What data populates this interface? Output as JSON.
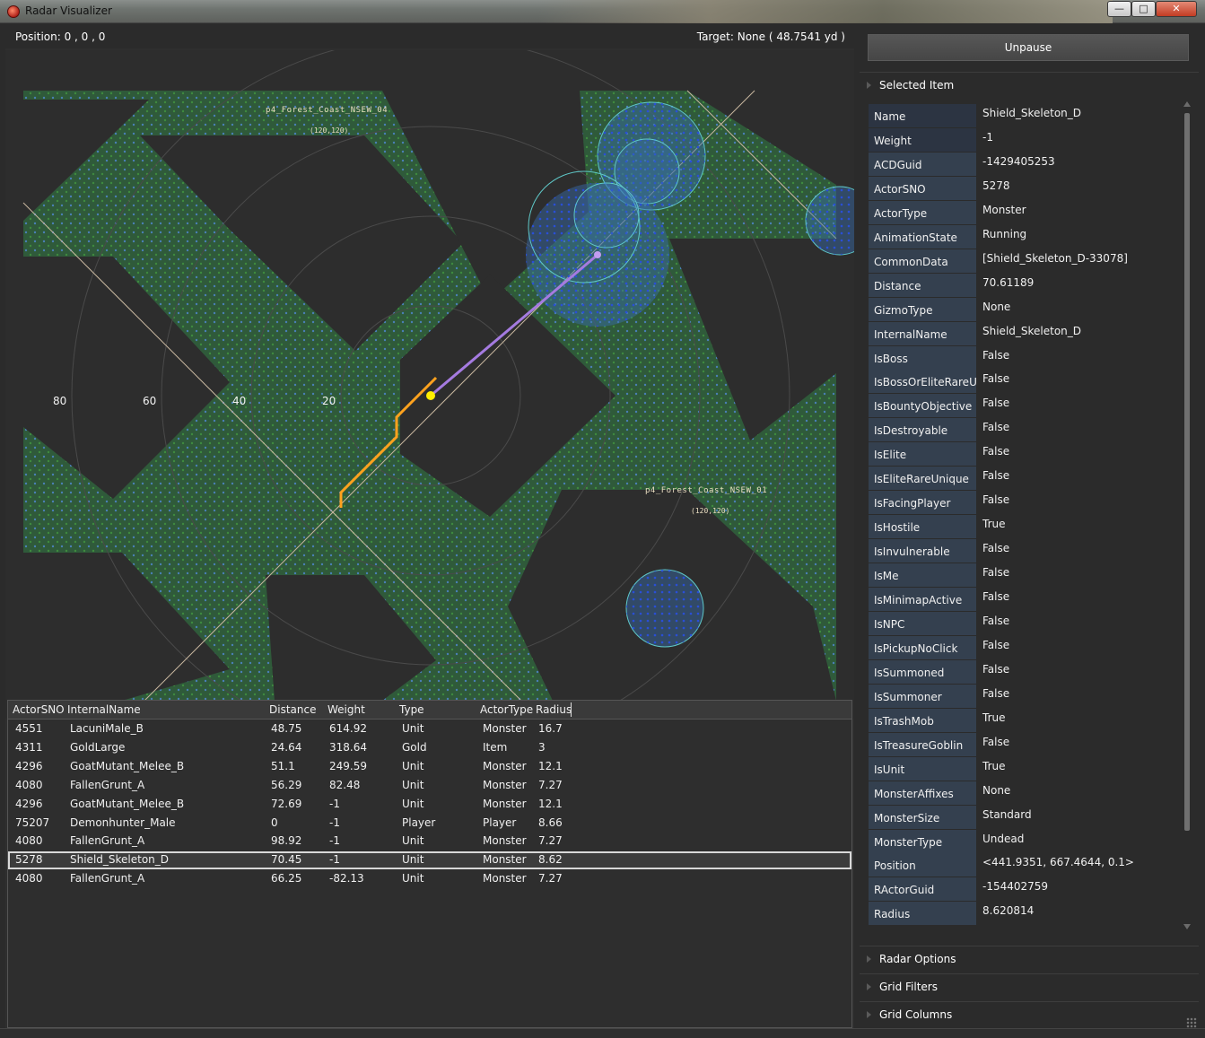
{
  "window": {
    "title": "Radar Visualizer"
  },
  "info": {
    "position": "Position: 0 , 0 , 0",
    "target": "Target: None ( 48.7541 yd )"
  },
  "radar": {
    "ring_labels": [
      "80",
      "60",
      "40",
      "20"
    ],
    "scenes": [
      {
        "name": "p4_Forest_Coast_NSEW_04",
        "coords": "(120,120)"
      },
      {
        "name": "p4_Forest_Coast_NSEW_01",
        "coords": "(120,120)"
      }
    ],
    "colors": {
      "walkable": "#2f5a3a",
      "player": "#ffee00",
      "path": "#ff9f1a",
      "target_line": "#a57be0",
      "monster": "#3a6fb0"
    }
  },
  "grid": {
    "columns": [
      "ActorSNO",
      "InternalName",
      "Distance",
      "Weight",
      "Type",
      "ActorType",
      "Radius"
    ],
    "rows": [
      [
        "4551",
        "LacuniMale_B",
        "48.75",
        "614.92",
        "Unit",
        "Monster",
        "16.7"
      ],
      [
        "4311",
        "GoldLarge",
        "24.64",
        "318.64",
        "Gold",
        "Item",
        "3"
      ],
      [
        "4296",
        "GoatMutant_Melee_B",
        "51.1",
        "249.59",
        "Unit",
        "Monster",
        "12.1"
      ],
      [
        "4080",
        "FallenGrunt_A",
        "56.29",
        "82.48",
        "Unit",
        "Monster",
        "7.27"
      ],
      [
        "4296",
        "GoatMutant_Melee_B",
        "72.69",
        "-1",
        "Unit",
        "Monster",
        "12.1"
      ],
      [
        "75207",
        "Demonhunter_Male",
        "0",
        "-1",
        "Player",
        "Player",
        "8.66"
      ],
      [
        "4080",
        "FallenGrunt_A",
        "98.92",
        "-1",
        "Unit",
        "Monster",
        "7.27"
      ],
      [
        "5278",
        "Shield_Skeleton_D",
        "70.45",
        "-1",
        "Unit",
        "Monster",
        "8.62"
      ],
      [
        "4080",
        "FallenGrunt_A",
        "66.25",
        "-82.13",
        "Unit",
        "Monster",
        "7.27"
      ]
    ],
    "selected_row": 7
  },
  "side": {
    "unpause_label": "Unpause",
    "selected_item_header": "Selected Item",
    "properties": [
      {
        "k": "Name",
        "v": "Shield_Skeleton_D"
      },
      {
        "k": "Weight",
        "v": "-1"
      },
      {
        "k": "ACDGuid",
        "v": "-1429405253"
      },
      {
        "k": "ActorSNO",
        "v": "5278"
      },
      {
        "k": "ActorType",
        "v": "Monster"
      },
      {
        "k": "AnimationState",
        "v": "Running"
      },
      {
        "k": "CommonData",
        "v": "[Shield_Skeleton_D-33078]"
      },
      {
        "k": "Distance",
        "v": "70.61189"
      },
      {
        "k": "GizmoType",
        "v": "None"
      },
      {
        "k": "InternalName",
        "v": "Shield_Skeleton_D"
      },
      {
        "k": "IsBoss",
        "v": "False"
      },
      {
        "k": "IsBossOrEliteRareUni",
        "v": "False"
      },
      {
        "k": "IsBountyObjective",
        "v": "False"
      },
      {
        "k": "IsDestroyable",
        "v": "False"
      },
      {
        "k": "IsElite",
        "v": "False"
      },
      {
        "k": "IsEliteRareUnique",
        "v": "False"
      },
      {
        "k": "IsFacingPlayer",
        "v": "False"
      },
      {
        "k": "IsHostile",
        "v": "True"
      },
      {
        "k": "IsInvulnerable",
        "v": "False"
      },
      {
        "k": "IsMe",
        "v": "False"
      },
      {
        "k": "IsMinimapActive",
        "v": "False"
      },
      {
        "k": "IsNPC",
        "v": "False"
      },
      {
        "k": "IsPickupNoClick",
        "v": "False"
      },
      {
        "k": "IsSummoned",
        "v": "False"
      },
      {
        "k": "IsSummoner",
        "v": "False"
      },
      {
        "k": "IsTrashMob",
        "v": "True"
      },
      {
        "k": "IsTreasureGoblin",
        "v": "False"
      },
      {
        "k": "IsUnit",
        "v": "True"
      },
      {
        "k": "MonsterAffixes",
        "v": "None"
      },
      {
        "k": "MonsterSize",
        "v": "Standard"
      },
      {
        "k": "MonsterType",
        "v": "Undead"
      },
      {
        "k": "Position",
        "v": "<441.9351, 667.4644, 0.1>"
      },
      {
        "k": "RActorGuid",
        "v": "-154402759"
      },
      {
        "k": "Radius",
        "v": "8.620814"
      }
    ],
    "sections": [
      "Radar Options",
      "Grid Filters",
      "Grid Columns"
    ]
  }
}
